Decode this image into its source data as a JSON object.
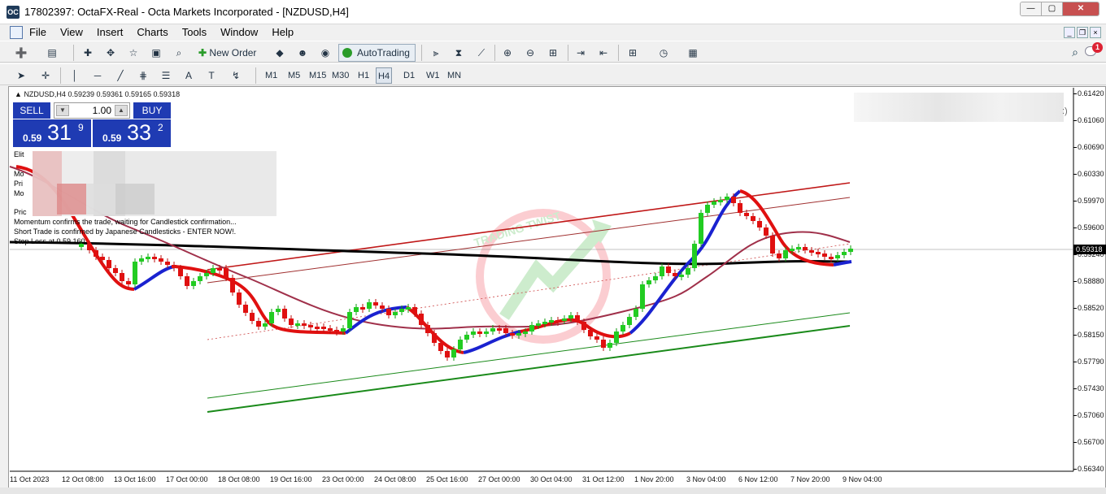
{
  "window": {
    "title": "17802397: OctaFX-Real - Octa Markets Incorporated - [NZDUSD,H4]",
    "app_icon": "OC"
  },
  "menu": {
    "items": [
      "File",
      "View",
      "Insert",
      "Charts",
      "Tools",
      "Window",
      "Help"
    ]
  },
  "toolbar": {
    "new_order": "New Order",
    "autotrading": "AutoTrading",
    "timeframes": [
      "M1",
      "M5",
      "M15",
      "M30",
      "H1",
      "H4",
      "D1",
      "W1",
      "MN"
    ],
    "active_timeframe": "H4",
    "drawing_letter": "A",
    "notification_count": "1"
  },
  "chart": {
    "header": "NZDUSD,H4  0.59239 0.59361 0.59165 0.59318",
    "current_price": "0.59318",
    "price_levels": [
      "0.61420",
      "0.61060",
      "0.60690",
      "0.60330",
      "0.59970",
      "0.59600",
      "0.59240",
      "0.58880",
      "0.58520",
      "0.58150",
      "0.57790",
      "0.57430",
      "0.57060",
      "0.56700",
      "0.56340"
    ],
    "time_labels": [
      "11 Oct 2023",
      "12 Oct 08:00",
      "13 Oct 16:00",
      "17 Oct 00:00",
      "18 Oct 08:00",
      "19 Oct 16:00",
      "23 Oct 00:00",
      "24 Oct 08:00",
      "25 Oct 16:00",
      "27 Oct 00:00",
      "30 Oct 04:00",
      "31 Oct 12:00",
      "1 Nov 20:00",
      "3 Nov 04:00",
      "6 Nov 12:00",
      "7 Nov 20:00",
      "9 Nov 04:00"
    ]
  },
  "trade_panel": {
    "sell_label": "SELL",
    "buy_label": "BUY",
    "lot": "1.00",
    "sell_prefix": "0.59",
    "sell_big": "31",
    "sell_sup": "9",
    "buy_prefix": "0.59",
    "buy_big": "33",
    "buy_sup": "2"
  },
  "indicator_text": {
    "line1": "Elit",
    "line2": "Mo",
    "line3": "Pri",
    "line4": "Mo",
    "line5": "Pric",
    "line6": "Momentum confirms the trade, waiting for Candlestick confirmation...",
    "line7": "Short Trade is confirmed by Japanese Candlesticks - ENTER NOW!.",
    "line8": "Stop Loss at 0.59 160"
  },
  "watermark": {
    "text": "TRADING TWIST"
  },
  "colors": {
    "sell_buy_bg": "#1f3bb3",
    "bull_candle": "#22cc22",
    "bear_candle": "#e01010",
    "ma_black": "#000000",
    "channel_red": "#c01818",
    "channel_green": "#1a8a1a",
    "hma_red": "#e01010",
    "hma_blue": "#1a22d0"
  }
}
